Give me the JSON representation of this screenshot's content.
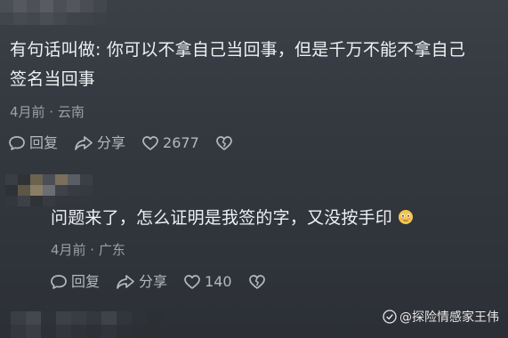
{
  "comment": {
    "text_line_1": "有句话叫做: 你可以不拿自己当回事，但是千万不能不拿自己",
    "text_line_2": "签名当回事",
    "meta": "4月前 · 云南",
    "reply_label": "回复",
    "share_label": "分享",
    "like_count": "2677"
  },
  "reply": {
    "text": "问题来了，怎么证明是我签的字，又没按手印",
    "meta": "4月前 · 广东",
    "reply_label": "回复",
    "share_label": "分享",
    "like_count": "140"
  },
  "watermark": {
    "text": "@探险情感家王伟"
  },
  "icons": {
    "reply": "comment-bubble-icon",
    "share": "share-arrow-icon",
    "like": "heart-icon",
    "dislike": "broken-heart-icon",
    "emoji": "flushed-face-emoji"
  },
  "colors": {
    "background": "#353a41",
    "primary_text": "#eef0f3",
    "secondary_text": "#9aa0a8",
    "action_text": "#b4b9c0"
  }
}
